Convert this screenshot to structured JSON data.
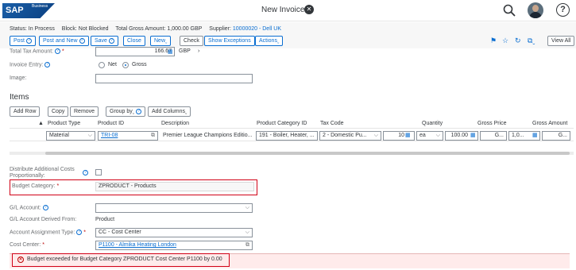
{
  "shell": {
    "logo_text": "SAP",
    "logo_sup": "Business",
    "title": "New Invoice",
    "close_icon": "close-circle-icon",
    "search_icon": "search-icon",
    "help_icon": "help-icon",
    "help_glyph": "?"
  },
  "header": {
    "status_label": "Status:",
    "status_value": "In Process",
    "block_label": "Block:",
    "block_value": "Not Blocked",
    "gross_label": "Total Gross Amount:",
    "gross_value": "1,000.00 GBP",
    "supplier_label": "Supplier:",
    "supplier_value": "10000020 - Dell UK"
  },
  "toolbar": {
    "post": "Post",
    "post_new": "Post and New",
    "save": "Save",
    "close": "Close",
    "new": "New",
    "check": "Check",
    "show_exceptions": "Show Exceptions",
    "actions": "Actions",
    "view_all": "View All"
  },
  "form": {
    "total_tax_label": "Total Tax Amount:",
    "total_tax_value": "166.67",
    "total_tax_currency": "GBP",
    "invoice_entry_label": "Invoice Entry:",
    "net_label": "Net",
    "gross_label": "Gross",
    "image_label": "Image:"
  },
  "items": {
    "title": "Items",
    "add_row": "Add Row",
    "copy": "Copy",
    "remove": "Remove",
    "group_by": "Group by",
    "add_columns": "Add Columns",
    "columns": [
      "Product Type",
      "Product ID",
      "Description",
      "Product Category ID",
      "Tax Code",
      "Quantity",
      "Gross Price",
      "Gross Amount"
    ],
    "row": {
      "product_type": "Material",
      "product_id": "TRI-08",
      "description": "Premier League Champions Editio...",
      "category": "191 - Boiler, Heater, ...",
      "tax_code": "2 - Domestic Pu...",
      "quantity": "10",
      "unit": "ea",
      "gross_price": "100.00",
      "price_unit": "G...",
      "gross_amount": "1,0...",
      "amount_unit": "G..."
    }
  },
  "cost": {
    "distribute_label": "Distribute Additional Costs Proportionally:",
    "budget_category_label": "Budget Category:",
    "budget_category_value": "ZPRODUCT - Products",
    "gl_account_label": "G/L Account:",
    "gl_derived_label": "G/L Account Derived From:",
    "gl_derived_value": "Product",
    "account_assignment_label": "Account Assignment Type:",
    "account_assignment_value": "CC - Cost Center",
    "cost_center_label": "Cost Center:",
    "cost_center_value": "P1100 - Almika Heating London"
  },
  "message": {
    "error_text": "Budget exceeded for Budget Category ZPRODUCT Cost Center P1100 by 0.00"
  },
  "colors": {
    "accent": "#0a6ed1",
    "error": "#bb0000",
    "highlight_border": "#d10016"
  }
}
